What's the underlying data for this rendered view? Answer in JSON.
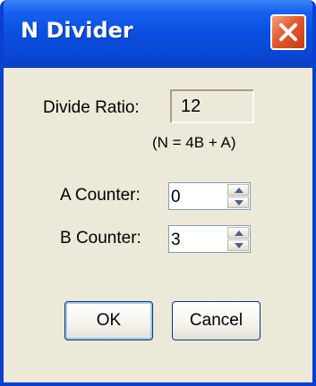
{
  "window": {
    "title": "N Divider"
  },
  "divide_ratio": {
    "label": "Divide Ratio:",
    "value": "12",
    "formula": "(N = 4B + A)"
  },
  "a_counter": {
    "label": "A Counter:",
    "value": "0"
  },
  "b_counter": {
    "label": "B Counter:",
    "value": "3"
  },
  "buttons": {
    "ok": "OK",
    "cancel": "Cancel"
  },
  "colors": {
    "titlebar": "#0a4fdf",
    "close": "#e35a2c",
    "dialog_bg": "#ece9d8"
  },
  "icons": {
    "close": "close-icon",
    "spin_up": "spin-up-arrow-icon",
    "spin_down": "spin-down-arrow-icon"
  }
}
